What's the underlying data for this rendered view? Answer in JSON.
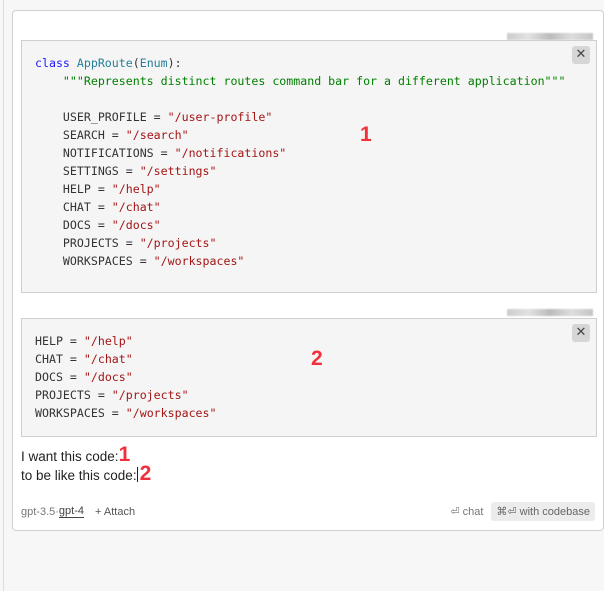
{
  "block1": {
    "lines": [
      [
        [
          "kw",
          "class "
        ],
        [
          "cls",
          "AppRoute"
        ],
        [
          "",
          "("
        ],
        [
          "cls",
          "Enum"
        ],
        [
          "",
          "):"
        ]
      ],
      [
        [
          "",
          "    "
        ],
        [
          "doc",
          "\"\"\"Represents distinct routes command bar for a different application\"\"\""
        ]
      ],
      [],
      [
        [
          "",
          "    USER_PROFILE = "
        ],
        [
          "str",
          "\"/user-profile\""
        ]
      ],
      [
        [
          "",
          "    SEARCH = "
        ],
        [
          "str",
          "\"/search\""
        ]
      ],
      [
        [
          "",
          "    NOTIFICATIONS = "
        ],
        [
          "str",
          "\"/notifications\""
        ]
      ],
      [
        [
          "",
          "    SETTINGS = "
        ],
        [
          "str",
          "\"/settings\""
        ]
      ],
      [
        [
          "",
          "    HELP = "
        ],
        [
          "str",
          "\"/help\""
        ]
      ],
      [
        [
          "",
          "    CHAT = "
        ],
        [
          "str",
          "\"/chat\""
        ]
      ],
      [
        [
          "",
          "    DOCS = "
        ],
        [
          "str",
          "\"/docs\""
        ]
      ],
      [
        [
          "",
          "    PROJECTS = "
        ],
        [
          "str",
          "\"/projects\""
        ]
      ],
      [
        [
          "",
          "    WORKSPACES = "
        ],
        [
          "str",
          "\"/workspaces\""
        ]
      ]
    ],
    "close": "✕",
    "annotation": "1"
  },
  "block2": {
    "lines": [
      [
        [
          "",
          "HELP = "
        ],
        [
          "str",
          "\"/help\""
        ]
      ],
      [
        [
          "",
          "CHAT = "
        ],
        [
          "str",
          "\"/chat\""
        ]
      ],
      [
        [
          "",
          "DOCS = "
        ],
        [
          "str",
          "\"/docs\""
        ]
      ],
      [
        [
          "",
          "PROJECTS = "
        ],
        [
          "str",
          "\"/projects\""
        ]
      ],
      [
        [
          "",
          "WORKSPACES = "
        ],
        [
          "str",
          "\"/workspaces\""
        ]
      ]
    ],
    "close": "✕",
    "annotation": "2"
  },
  "input": {
    "line1": "I want this code:",
    "mark1": "1",
    "line2": "to be like this code:",
    "mark2": "2"
  },
  "footer": {
    "model1": "gpt-3.5",
    "sep": " · ",
    "model2": "gpt-4",
    "attach": "+ Attach",
    "chat": "⏎ chat",
    "codebase": "⌘⏎ with codebase"
  },
  "colors": {
    "annotation": "#f0303a",
    "keyword": "#1a1aff",
    "string": "#a31515",
    "docstring": "#008000"
  }
}
